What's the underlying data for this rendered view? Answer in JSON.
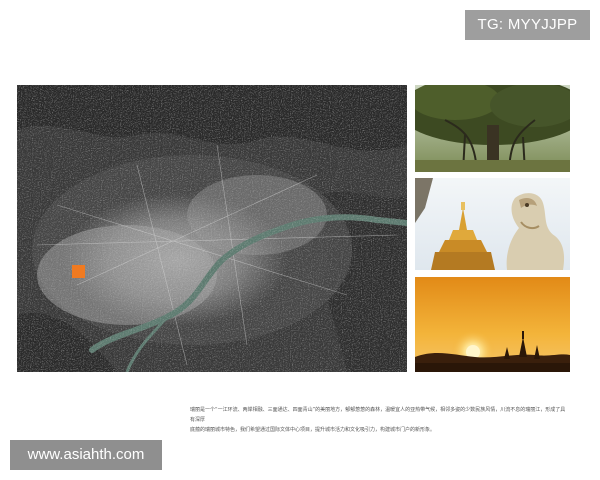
{
  "header": {
    "tg_badge": "TG: MYYJJPP"
  },
  "images": {
    "satellite_map": "satellite-map",
    "tree_photo": "banyan-tree-photo",
    "temple_photo": "golden-pagoda-and-lion-statue-photo",
    "sunset_photo": "pagoda-sunset-photo"
  },
  "caption": {
    "line1": "瑞丽是一个“一江环流、两岸相融、三面通达、四面青山”的美丽地方，郁郁葱葱的森林，温暖宜人的亚热带气候，相邻多姿的少数民族风情，川流不息的瑞丽江，形成了具有深厚",
    "line2": "底蕴的瑞丽城市特色，我们希望通过国际文体中心项目，提升城市活力和文化吸引力，构建城市门户的新形象。"
  },
  "footer": {
    "watermark": "www.asiahth.com"
  },
  "colors": {
    "badge_bg": "#9e9e9e",
    "watermark_bg": "#8f8f8f",
    "site_marker": "#f07a20",
    "river": "#5f7d72"
  }
}
